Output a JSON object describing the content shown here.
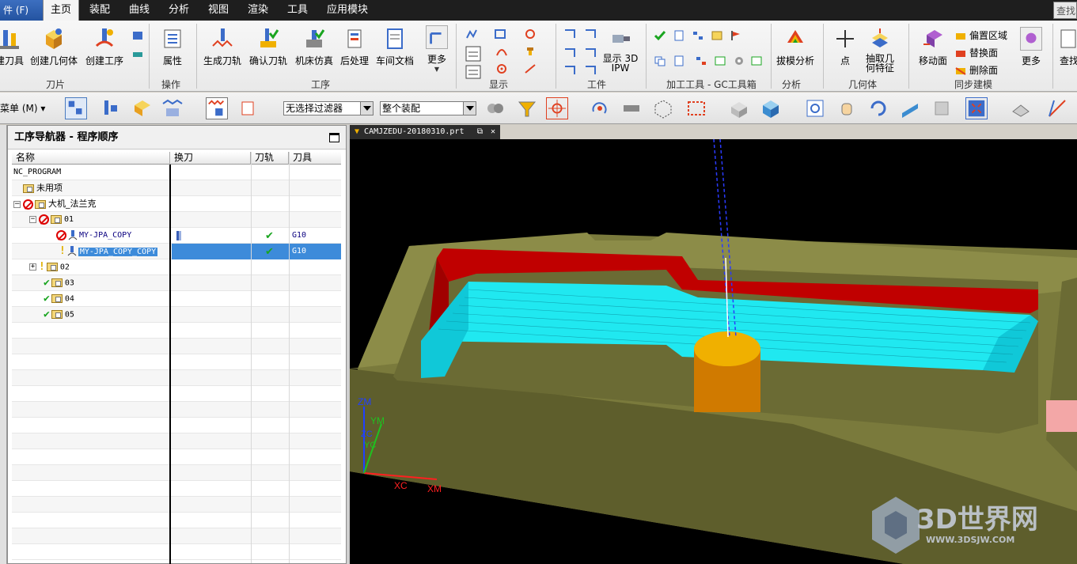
{
  "menu": {
    "file": "件 (F)",
    "tabs": [
      "主页",
      "装配",
      "曲线",
      "分析",
      "视图",
      "渲染",
      "工具",
      "应用模块"
    ],
    "search": "查找"
  },
  "ribbon": {
    "groups": {
      "tool": "刀片",
      "ops": "操作",
      "operation": "工序",
      "display": "显示",
      "workpiece": "工件",
      "gc": "加工工具 - GC工具箱",
      "analysis": "分析",
      "geometry": "几何体",
      "sync": "同步建模"
    },
    "buttons": {
      "create_tool": "建刀具",
      "create_geometry": "创建几何体",
      "create_operation": "创建工序",
      "properties": "属性",
      "generate_path": "生成刀轨",
      "verify_path": "确认刀轨",
      "machine_sim": "机床仿真",
      "postprocess": "后处理",
      "shop_doc": "车间文档",
      "more1": "更多",
      "show_3d_ipw": "显示 3D IPW",
      "draft_analysis": "拔模分析",
      "point": "点",
      "extract_geometry": "抽取几何特征",
      "move_face": "移动面",
      "offset_region": "偏置区域",
      "replace_face": "替换面",
      "delete_face": "删除面",
      "more2": "更多",
      "find": "查找"
    }
  },
  "toolbar": {
    "menu_label": "菜单 (M)",
    "filter_value": "无选择过滤器",
    "assembly_value": "整个装配"
  },
  "navigator": {
    "title": "工序导航器 - 程序顺序",
    "columns": [
      "名称",
      "换刀",
      "刀轨",
      "刀具"
    ],
    "rows": [
      {
        "name": "NC_PROGRAM",
        "tool": "",
        "path": "",
        "tl": ""
      },
      {
        "name": "未用项",
        "tool": "",
        "path": "",
        "tl": ""
      },
      {
        "name": "大机_法兰克",
        "tool": "",
        "path": "",
        "tl": ""
      },
      {
        "name": "01",
        "tool": "",
        "path": "",
        "tl": ""
      },
      {
        "name": "MY-JPA_COPY",
        "tool": "",
        "path": "✔",
        "tl": "G10"
      },
      {
        "name": "MY-JPA_COPY_COPY",
        "tool": "",
        "path": "✔",
        "tl": "G10"
      },
      {
        "name": "02",
        "tool": "",
        "path": "",
        "tl": ""
      },
      {
        "name": "03",
        "tool": "",
        "path": "",
        "tl": ""
      },
      {
        "name": "04",
        "tool": "",
        "path": "",
        "tl": ""
      },
      {
        "name": "05",
        "tool": "",
        "path": "",
        "tl": ""
      }
    ]
  },
  "viewport": {
    "file_tab": "CAMJZEDU-20180310.prt",
    "axes": {
      "zm": "ZM",
      "ym": "YM",
      "zc": "ZC",
      "yc": "YC",
      "xc": "XC",
      "xm": "XM"
    },
    "watermark": "3D世界网",
    "watermark_url": "WWW.3DSJW.COM"
  },
  "colors": {
    "part": "#7a7a3c",
    "wall_red": "#c00000",
    "toolpath_cyan": "#20e8f0",
    "cutter": "#f0b000",
    "selection": "#3d8bda"
  }
}
